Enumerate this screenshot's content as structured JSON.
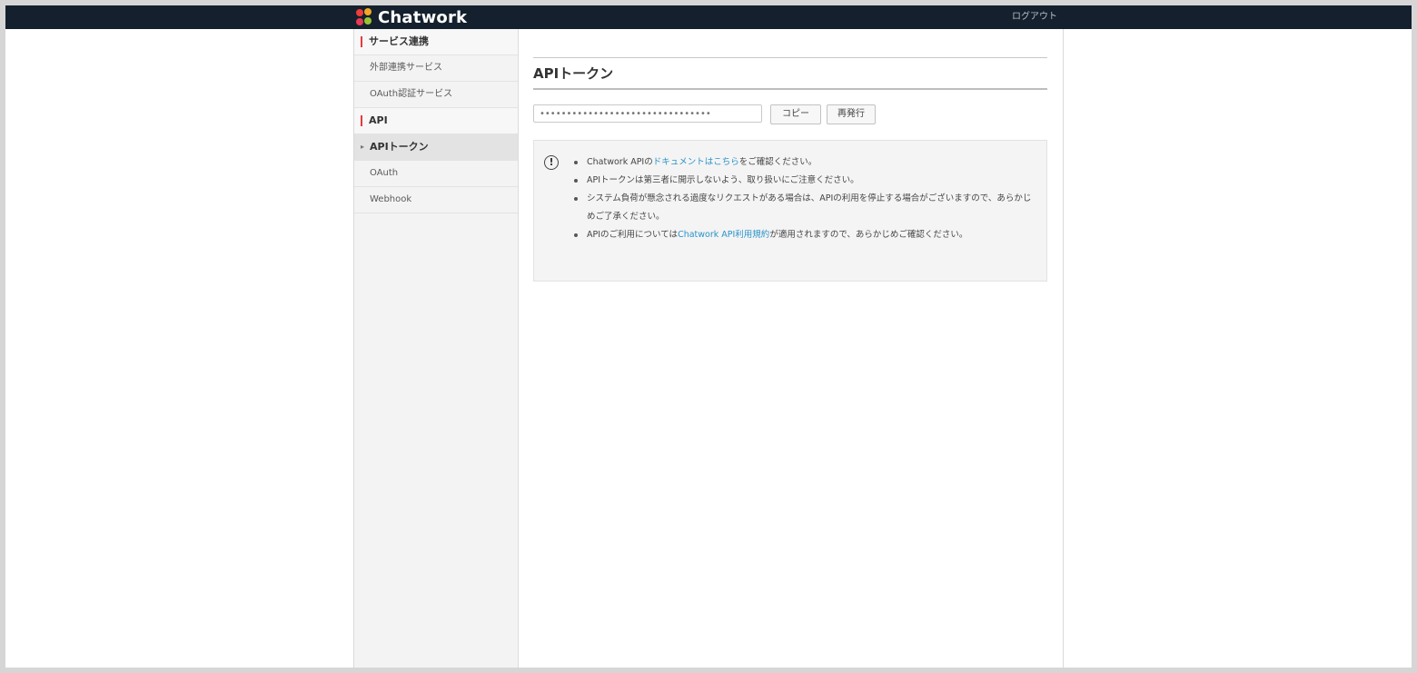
{
  "app": {
    "brand": "Chatwork",
    "logout_label": "ログアウト"
  },
  "sidebar": {
    "sections": [
      {
        "heading": "サービス連携",
        "items": [
          "外部連携サービス",
          "OAuth認証サービス"
        ]
      },
      {
        "heading": "API",
        "items": [
          "APIトークン",
          "OAuth",
          "Webhook"
        ]
      }
    ],
    "active_item": "APIトークン"
  },
  "main": {
    "title": "APIトークン",
    "token_placeholder": "••••••••••••••••••••••••••••••••",
    "copy_label": "コピー",
    "reissue_label": "再発行",
    "notices": [
      {
        "before": "Chatwork APIの",
        "link": "ドキュメントはこちら",
        "after": "をご確認ください。"
      },
      {
        "before": "APIトークンは第三者に開示しないよう、取り扱いにご注意ください。",
        "link": "",
        "after": ""
      },
      {
        "before": "システム負荷が懸念される過度なリクエストがある場合は、APIの利用を停止する場合がございますので、あらかじめご了承ください。",
        "link": "",
        "after": ""
      },
      {
        "before": "APIのご利用については",
        "link": "Chatwork API利用規約",
        "after": "が適用されますので、あらかじめご確認ください。"
      }
    ]
  },
  "colors": {
    "topbar": "#15202e",
    "accent_red": "#e83a3a",
    "link": "#2a93c9"
  }
}
